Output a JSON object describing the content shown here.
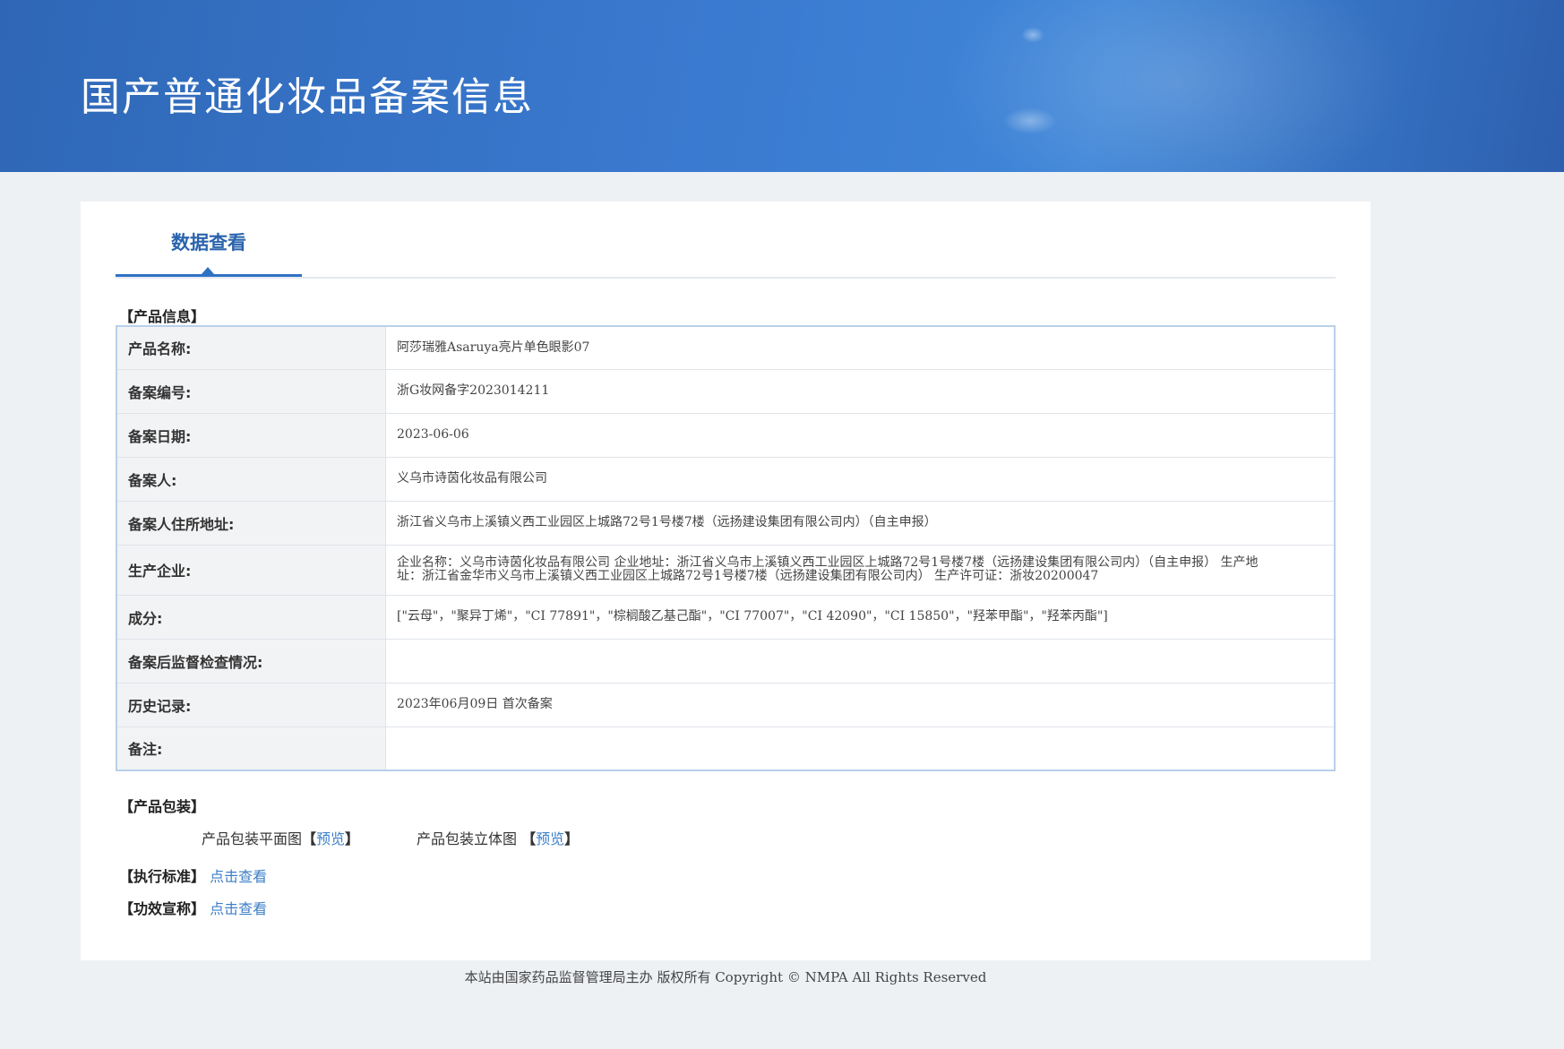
{
  "header": {
    "title": "国产普通化妆品备案信息"
  },
  "tab": {
    "label": "数据查看"
  },
  "sections": {
    "product_info": "【产品信息】",
    "packaging": "【产品包装】"
  },
  "info_rows": [
    {
      "key": "产品名称:",
      "value": "阿莎瑞雅Asaruya亮片单色眼影07"
    },
    {
      "key": "备案编号:",
      "value": "浙G妆网备字2023014211"
    },
    {
      "key": "备案日期:",
      "value": "2023-06-06"
    },
    {
      "key": "备案人:",
      "value": "义乌市诗茵化妆品有限公司"
    },
    {
      "key": "备案人住所地址:",
      "value": "浙江省义乌市上溪镇义西工业园区上城路72号1号楼7楼（远扬建设集团有限公司内）（自主申报）"
    },
    {
      "key": "生产企业:",
      "value": "企业名称：义乌市诗茵化妆品有限公司 企业地址：浙江省义乌市上溪镇义西工业园区上城路72号1号楼7楼（远扬建设集团有限公司内）（自主申报） 生产地址：浙江省金华市义乌市上溪镇义西工业园区上城路72号1号楼7楼（远扬建设集团有限公司内） 生产许可证：浙妆20200047"
    },
    {
      "key": "成分:",
      "value": "[\"云母\"，\"聚异丁烯\"，\"CI 77891\"，\"棕榈酸乙基己酯\"，\"CI 77007\"，\"CI 42090\"，\"CI 15850\"，\"羟苯甲酯\"，\"羟苯丙酯\"]"
    },
    {
      "key": "备案后监督检查情况:",
      "value": ""
    },
    {
      "key": "历史记录:",
      "value": "2023年06月09日 首次备案"
    },
    {
      "key": "备注:",
      "value": ""
    }
  ],
  "packaging": {
    "flat_label": "产品包装平面图",
    "flat_link": "预览",
    "solid_label": "产品包装立体图",
    "solid_link": "预览"
  },
  "standard": {
    "label": "【执行标准】",
    "link": "点击查看"
  },
  "claims": {
    "label": "【功效宣称】",
    "link": "点击查看"
  },
  "footer": {
    "text": "本站由国家药品监督管理局主办 版权所有 Copyright © NMPA All Rights Reserved"
  }
}
